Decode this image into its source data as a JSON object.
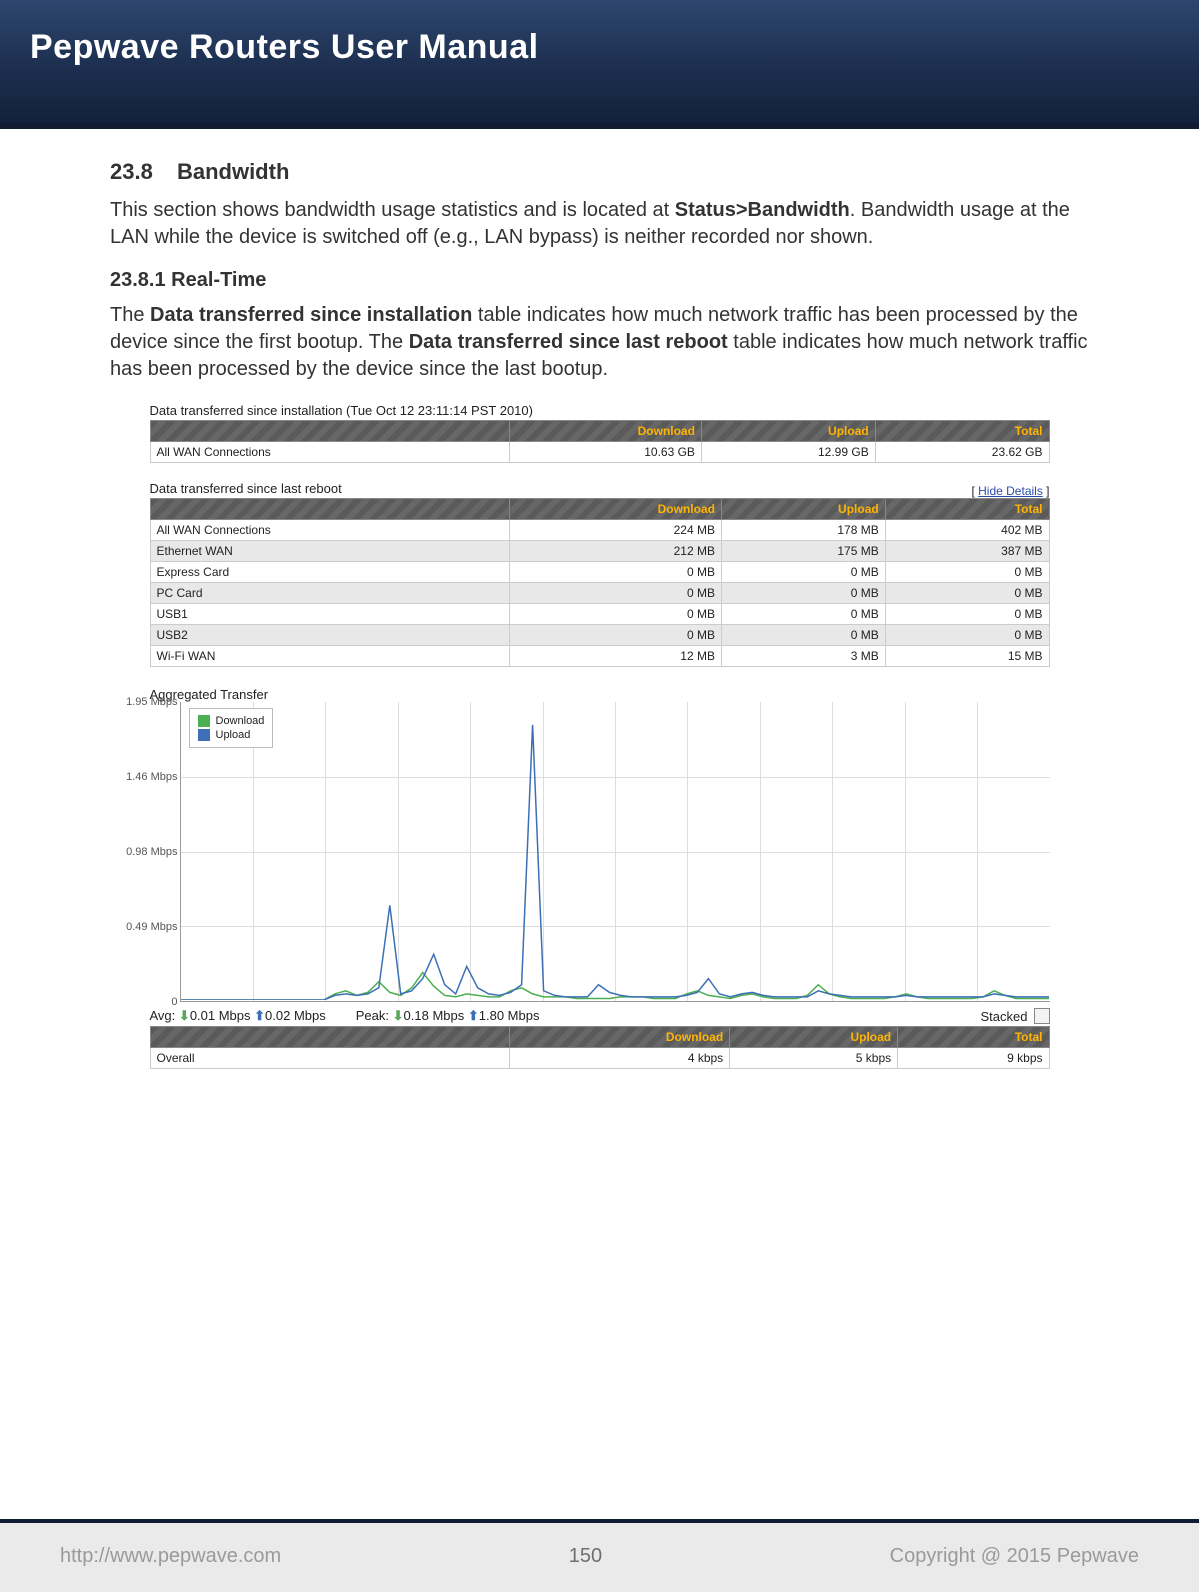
{
  "header": {
    "title": "Pepwave Routers User Manual"
  },
  "section": {
    "num": "23.8",
    "title": "Bandwidth",
    "intro_pre": "This section shows bandwidth usage statistics and is located at ",
    "intro_bold": "Status>Bandwidth",
    "intro_post": ". Bandwidth usage at the LAN while the device is switched off (e.g., LAN bypass) is neither recorded nor shown."
  },
  "subsection": {
    "num": "23.8.1",
    "title": "Real-Time",
    "p_pre": "The ",
    "p_b1": "Data transferred since installation",
    "p_mid": " table indicates how much network traffic has been processed by the device since the first bootup. The ",
    "p_b2": "Data transferred since last reboot",
    "p_post": " table indicates how much network traffic has been processed by the device since the last bootup."
  },
  "install_table": {
    "caption": "Data transferred since installation (Tue Oct 12 23:11:14 PST 2010)",
    "headers": {
      "c1": "",
      "download": "Download",
      "upload": "Upload",
      "total": "Total"
    },
    "rows": [
      {
        "name": "All WAN Connections",
        "download": "10.63 GB",
        "upload": "12.99 GB",
        "total": "23.62 GB"
      }
    ]
  },
  "reboot_table": {
    "caption": "Data transferred since last reboot",
    "hide_details": "Hide Details",
    "headers": {
      "c1": "",
      "download": "Download",
      "upload": "Upload",
      "total": "Total"
    },
    "rows": [
      {
        "name": "All WAN Connections",
        "download": "224 MB",
        "upload": "178 MB",
        "total": "402 MB"
      },
      {
        "name": "Ethernet WAN",
        "download": "212 MB",
        "upload": "175 MB",
        "total": "387 MB"
      },
      {
        "name": "Express Card",
        "download": "0 MB",
        "upload": "0 MB",
        "total": "0 MB"
      },
      {
        "name": "PC Card",
        "download": "0 MB",
        "upload": "0 MB",
        "total": "0 MB"
      },
      {
        "name": "USB1",
        "download": "0 MB",
        "upload": "0 MB",
        "total": "0 MB"
      },
      {
        "name": "USB2",
        "download": "0 MB",
        "upload": "0 MB",
        "total": "0 MB"
      },
      {
        "name": "Wi-Fi WAN",
        "download": "12 MB",
        "upload": "3 MB",
        "total": "15 MB"
      }
    ]
  },
  "chart": {
    "title": "Aggregated Transfer",
    "legend": {
      "download": "Download",
      "upload": "Upload"
    },
    "y_ticks": [
      "1.95 Mbps",
      "1.46 Mbps",
      "0.98 Mbps",
      "0.49 Mbps",
      "0"
    ],
    "stats": {
      "avg_label": "Avg:",
      "avg_down": "0.01 Mbps",
      "avg_up": "0.02 Mbps",
      "peak_label": "Peak:",
      "peak_down": "0.18 Mbps",
      "peak_up": "1.80 Mbps",
      "stacked_label": "Stacked"
    },
    "colors": {
      "download": "#4caf50",
      "upload": "#3c6fb5"
    },
    "overall_headers": {
      "c1": "",
      "download": "Download",
      "upload": "Upload",
      "total": "Total"
    },
    "overall": {
      "name": "Overall",
      "download": "4 kbps",
      "upload": "5 kbps",
      "total": "9 kbps"
    }
  },
  "chart_data": {
    "type": "line",
    "title": "Aggregated Transfer",
    "ylabel": "Mbps",
    "ylim": [
      0,
      1.95
    ],
    "x_unit": "time (seconds, recent window)",
    "x": [
      0,
      1,
      2,
      3,
      4,
      5,
      6,
      7,
      8,
      9,
      10,
      11,
      12,
      13,
      14,
      15,
      16,
      17,
      18,
      19,
      20,
      21,
      22,
      23,
      24,
      25,
      26,
      27,
      28,
      29,
      30,
      31,
      32,
      33,
      34,
      35,
      36,
      37,
      38,
      39,
      40,
      41,
      42,
      43,
      44,
      45,
      46,
      47,
      48,
      49,
      50,
      51,
      52,
      53,
      54,
      55,
      56,
      57,
      58,
      59,
      60,
      61,
      62,
      63,
      64,
      65,
      66,
      67,
      68,
      69,
      70,
      71,
      72,
      73,
      74,
      75,
      76,
      77,
      78,
      79
    ],
    "series": [
      {
        "name": "Download",
        "color": "#4caf50",
        "values": [
          0,
          0,
          0,
          0,
          0,
          0,
          0,
          0,
          0,
          0,
          0,
          0,
          0,
          0,
          0.04,
          0.06,
          0.03,
          0.05,
          0.12,
          0.05,
          0.03,
          0.08,
          0.18,
          0.09,
          0.03,
          0.02,
          0.04,
          0.03,
          0.02,
          0.02,
          0.06,
          0.08,
          0.04,
          0.02,
          0.02,
          0.02,
          0.01,
          0.01,
          0.01,
          0.01,
          0.02,
          0.02,
          0.02,
          0.01,
          0.01,
          0.01,
          0.04,
          0.06,
          0.03,
          0.02,
          0.01,
          0.03,
          0.04,
          0.02,
          0.01,
          0.01,
          0.01,
          0.03,
          0.1,
          0.04,
          0.02,
          0.01,
          0.01,
          0.01,
          0.01,
          0.02,
          0.04,
          0.02,
          0.01,
          0.01,
          0.01,
          0.01,
          0.01,
          0.02,
          0.06,
          0.03,
          0.01,
          0.01,
          0.01,
          0.01
        ]
      },
      {
        "name": "Upload",
        "color": "#3c6fb5",
        "values": [
          0,
          0,
          0,
          0,
          0,
          0,
          0,
          0,
          0,
          0,
          0,
          0,
          0,
          0,
          0.03,
          0.04,
          0.03,
          0.04,
          0.08,
          0.62,
          0.04,
          0.06,
          0.14,
          0.3,
          0.1,
          0.04,
          0.22,
          0.08,
          0.04,
          0.03,
          0.05,
          0.1,
          1.8,
          0.06,
          0.03,
          0.02,
          0.02,
          0.02,
          0.1,
          0.05,
          0.03,
          0.02,
          0.02,
          0.02,
          0.02,
          0.02,
          0.03,
          0.05,
          0.14,
          0.04,
          0.02,
          0.04,
          0.05,
          0.03,
          0.02,
          0.02,
          0.02,
          0.02,
          0.06,
          0.04,
          0.03,
          0.02,
          0.02,
          0.02,
          0.02,
          0.02,
          0.03,
          0.02,
          0.02,
          0.02,
          0.02,
          0.02,
          0.02,
          0.02,
          0.04,
          0.03,
          0.02,
          0.02,
          0.02,
          0.02
        ]
      }
    ],
    "average": {
      "download_mbps": 0.01,
      "upload_mbps": 0.02
    },
    "peak": {
      "download_mbps": 0.18,
      "upload_mbps": 1.8
    },
    "overall_kbps": {
      "download": 4,
      "upload": 5,
      "total": 9
    }
  },
  "footer": {
    "url": "http://www.pepwave.com",
    "page": "150",
    "copyright": "Copyright @ 2015 Pepwave"
  }
}
